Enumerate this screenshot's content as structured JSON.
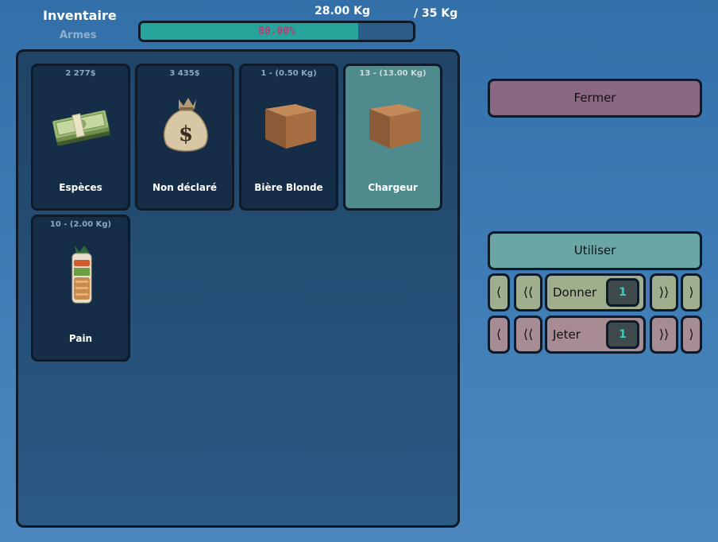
{
  "header": {
    "title": "Inventaire",
    "subtitle": "Armes",
    "weight_current": "28.00 Kg",
    "weight_max": "/ 35 Kg",
    "progress_label": "80.00%",
    "progress_value": 80
  },
  "items": [
    {
      "top": "2 277$",
      "name": "Espèces",
      "icon": "cash-stack-icon"
    },
    {
      "top": "3 435$",
      "name": "Non déclaré",
      "icon": "money-bag-icon"
    },
    {
      "top": "1 - (0.50 Kg)",
      "name": "Bière Blonde",
      "icon": "cardboard-box-icon"
    },
    {
      "top": "13 - (13.00 Kg)",
      "name": "Chargeur",
      "icon": "cardboard-box-icon",
      "selected": true
    },
    {
      "top": "10 - (2.00 Kg)",
      "name": "Pain",
      "icon": "bread-bag-icon"
    }
  ],
  "actions": {
    "close_label": "Fermer",
    "use_label": "Utiliser",
    "give": {
      "label": "Donner",
      "quantity": "1",
      "prev": "⟨",
      "prev_fast": "⟨⟨",
      "next_fast": "⟩⟩",
      "next": "⟩"
    },
    "drop": {
      "label": "Jeter",
      "quantity": "1",
      "prev": "⟨",
      "prev_fast": "⟨⟨",
      "next_fast": "⟩⟩",
      "next": "⟩"
    }
  },
  "colors": {
    "accent": "#27a59a",
    "close_button": "#8a6883",
    "use_button": "#6aa7a4",
    "give_row": "#9fae8c",
    "drop_row": "#a78c93",
    "quantity_text": "#2fd3c1",
    "progress_text": "#b53b73"
  }
}
